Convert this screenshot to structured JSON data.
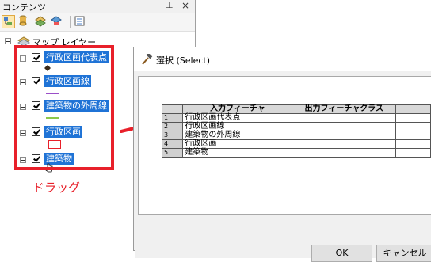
{
  "contents_pane": {
    "title": "コンテンツ",
    "pin_glyph": "⊥",
    "close_glyph": "×",
    "root_label": "マップ レイヤー",
    "layers": [
      {
        "label": "行政区画代表点",
        "symbol": "point"
      },
      {
        "label": "行政区画線",
        "symbol": "line-purple"
      },
      {
        "label": "建築物の外周線",
        "symbol": "line-green"
      },
      {
        "label": "行政区画",
        "symbol": "polygon-red"
      },
      {
        "label": "建築物",
        "symbol": "none"
      }
    ]
  },
  "annotation": {
    "drag_label": "ドラッグ",
    "highlight_color": "#e8202a"
  },
  "dialog": {
    "title": "選択 (Select)",
    "columns": [
      "入力フィーチャ",
      "出力フィーチャクラス"
    ],
    "rows": [
      {
        "num": "1",
        "input": "行政区画代表点",
        "output": ""
      },
      {
        "num": "2",
        "input": "行政区画線",
        "output": ""
      },
      {
        "num": "3",
        "input": "建築物の外周線",
        "output": ""
      },
      {
        "num": "4",
        "input": "行政区画",
        "output": ""
      },
      {
        "num": "5",
        "input": "建築物",
        "output": ""
      }
    ],
    "ok_label": "OK",
    "cancel_label": "キャンセル"
  },
  "colors": {
    "selection_blue": "#1f73d6",
    "accent_red": "#e8202a"
  }
}
